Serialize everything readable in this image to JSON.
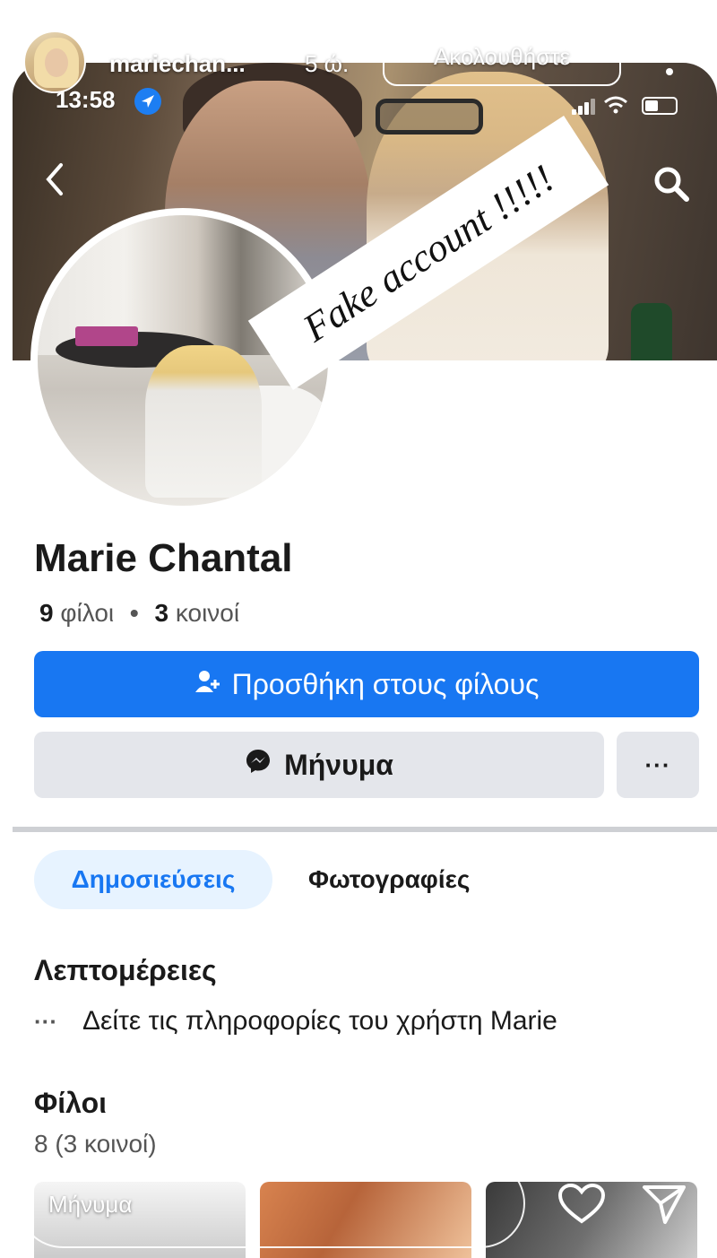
{
  "story": {
    "username": "mariechan...",
    "time_ago": "5 ώ.",
    "follow_label": "Ακολουθήστε",
    "more_icon": "more-vertical-icon",
    "reply_placeholder": "Μήνυμα",
    "heart_icon": "heart-icon",
    "send_icon": "send-icon"
  },
  "phone_status": {
    "time": "13:58",
    "location_icon": "location-arrow-icon",
    "signal_icon": "cellular-signal-icon",
    "wifi_icon": "wifi-icon",
    "battery_icon": "battery-icon"
  },
  "overlay_text": "Fake account !!!!!",
  "profile": {
    "back_icon": "back-chevron-icon",
    "search_icon": "search-icon",
    "name": "Marie Chantal",
    "friends_count": "9",
    "friends_word": "φίλοι",
    "mutual_count": "3",
    "mutual_word": "κοινοί",
    "add_friend_label": "Προσθήκη στους φίλους",
    "message_label": "Μήνυμα",
    "more_label": "···"
  },
  "tabs": [
    {
      "label": "Δημοσιεύσεις",
      "active": true
    },
    {
      "label": "Φωτογραφίες",
      "active": false
    }
  ],
  "details": {
    "title": "Λεπτομέρειες",
    "dots": "···",
    "row_text": "Δείτε τις πληροφορίες του χρήστη Marie"
  },
  "friends_section": {
    "title": "Φίλοι",
    "count_text": "8 (3 κοινοί)"
  },
  "colors": {
    "facebook_blue": "#1877f2",
    "button_gray": "#e4e6eb",
    "tab_active_bg": "#e7f3ff"
  }
}
